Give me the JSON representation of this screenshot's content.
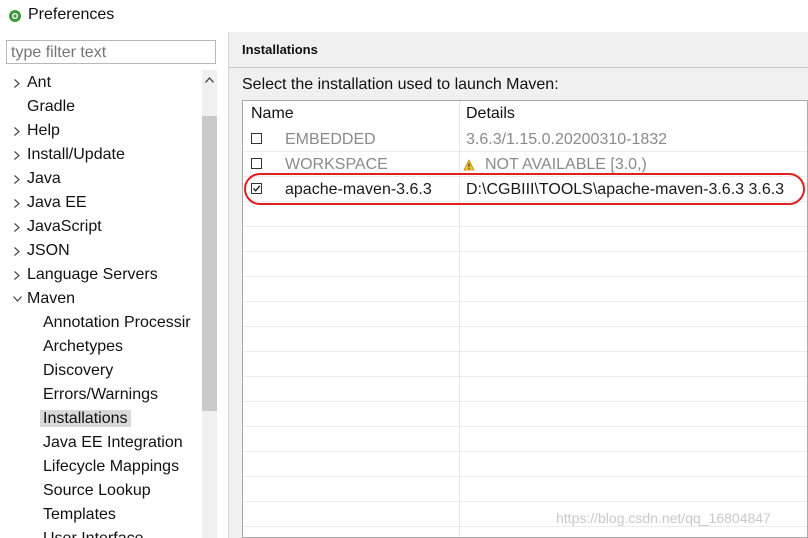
{
  "window": {
    "title": "Preferences"
  },
  "filter": {
    "placeholder": "type filter text"
  },
  "tree": {
    "items": [
      {
        "label": "Ant",
        "depth": 0,
        "expander": "collapsed"
      },
      {
        "label": "Gradle",
        "depth": 0,
        "expander": "none"
      },
      {
        "label": "Help",
        "depth": 0,
        "expander": "collapsed"
      },
      {
        "label": "Install/Update",
        "depth": 0,
        "expander": "collapsed"
      },
      {
        "label": "Java",
        "depth": 0,
        "expander": "collapsed"
      },
      {
        "label": "Java EE",
        "depth": 0,
        "expander": "collapsed"
      },
      {
        "label": "JavaScript",
        "depth": 0,
        "expander": "collapsed"
      },
      {
        "label": "JSON",
        "depth": 0,
        "expander": "collapsed"
      },
      {
        "label": "Language Servers",
        "depth": 0,
        "expander": "collapsed"
      },
      {
        "label": "Maven",
        "depth": 0,
        "expander": "expanded"
      },
      {
        "label": "Annotation Processir",
        "depth": 1,
        "expander": "none"
      },
      {
        "label": "Archetypes",
        "depth": 1,
        "expander": "none"
      },
      {
        "label": "Discovery",
        "depth": 1,
        "expander": "none"
      },
      {
        "label": "Errors/Warnings",
        "depth": 1,
        "expander": "none"
      },
      {
        "label": "Installations",
        "depth": 1,
        "expander": "none",
        "selected": true
      },
      {
        "label": "Java EE Integration",
        "depth": 1,
        "expander": "none"
      },
      {
        "label": "Lifecycle Mappings",
        "depth": 1,
        "expander": "none"
      },
      {
        "label": "Source Lookup",
        "depth": 1,
        "expander": "none"
      },
      {
        "label": "Templates",
        "depth": 1,
        "expander": "none"
      },
      {
        "label": "User Interface",
        "depth": 1,
        "expander": "none"
      }
    ]
  },
  "section": {
    "title": "Installations",
    "instruction": "Select the installation used to launch Maven:"
  },
  "table": {
    "headers": {
      "name": "Name",
      "details": "Details"
    },
    "rows": [
      {
        "checked": false,
        "name": "EMBEDDED",
        "details": "3.6.3/1.15.0.20200310-1832",
        "disabled": true,
        "warning": false
      },
      {
        "checked": false,
        "name": "WORKSPACE",
        "details": "NOT AVAILABLE [3.0,)",
        "disabled": true,
        "warning": true
      },
      {
        "checked": true,
        "name": "apache-maven-3.6.3",
        "details": "D:\\CGBIII\\TOOLS\\apache-maven-3.6.3 3.6.3",
        "disabled": false,
        "warning": false
      }
    ]
  },
  "watermark": "https://blog.csdn.net/qq_16804847",
  "colors": {
    "highlight": "#e0201c",
    "selected_bg": "#d9d9d9",
    "panel_bg": "#f0f0f0"
  }
}
